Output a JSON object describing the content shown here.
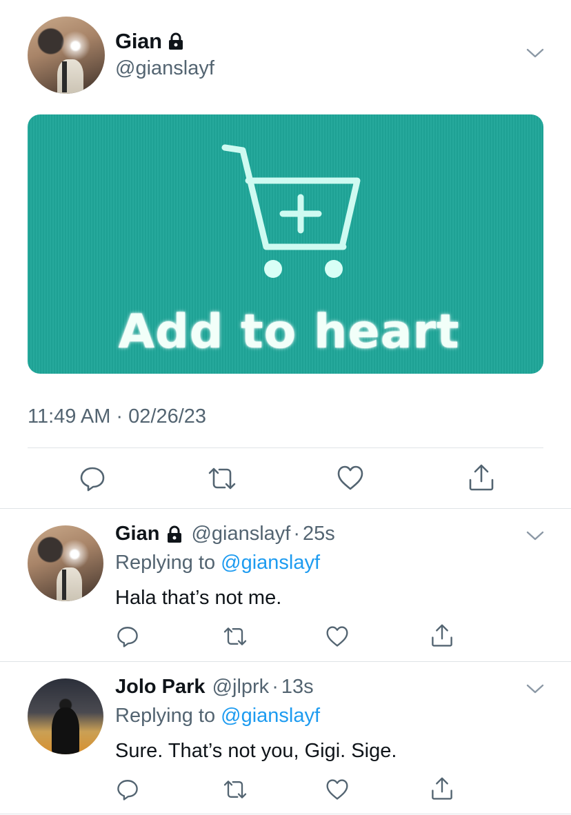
{
  "tweet": {
    "author": {
      "name": "Gian",
      "handle": "@gianslayf",
      "protected_icon": "lock-icon"
    },
    "media": {
      "caption": "Add to heart",
      "icon": "cart-plus-icon",
      "background_color": "#1fa699"
    },
    "timestamp": "11:49 AM · 02/26/23",
    "actions": [
      "reply-icon",
      "retweet-icon",
      "like-icon",
      "share-icon"
    ],
    "menu_icon": "chevron-down-icon"
  },
  "replies": [
    {
      "name": "Gian",
      "protected_icon": "lock-icon",
      "handle": "@gianslayf",
      "separator": "·",
      "time": "25s",
      "replying_prefix": "Replying to",
      "replying_to": "@gianslayf",
      "text": "Hala that’s not me."
    },
    {
      "name": "Jolo Park",
      "handle": "@jlprk",
      "separator": "·",
      "time": "13s",
      "replying_prefix": "Replying to",
      "replying_to": "@gianslayf",
      "text": "Sure. That’s not you, Gigi. Sige."
    }
  ],
  "colors": {
    "text_primary": "#0f1419",
    "text_secondary": "#536471",
    "link": "#1d9bf0",
    "divider": "#dfe3e6"
  }
}
